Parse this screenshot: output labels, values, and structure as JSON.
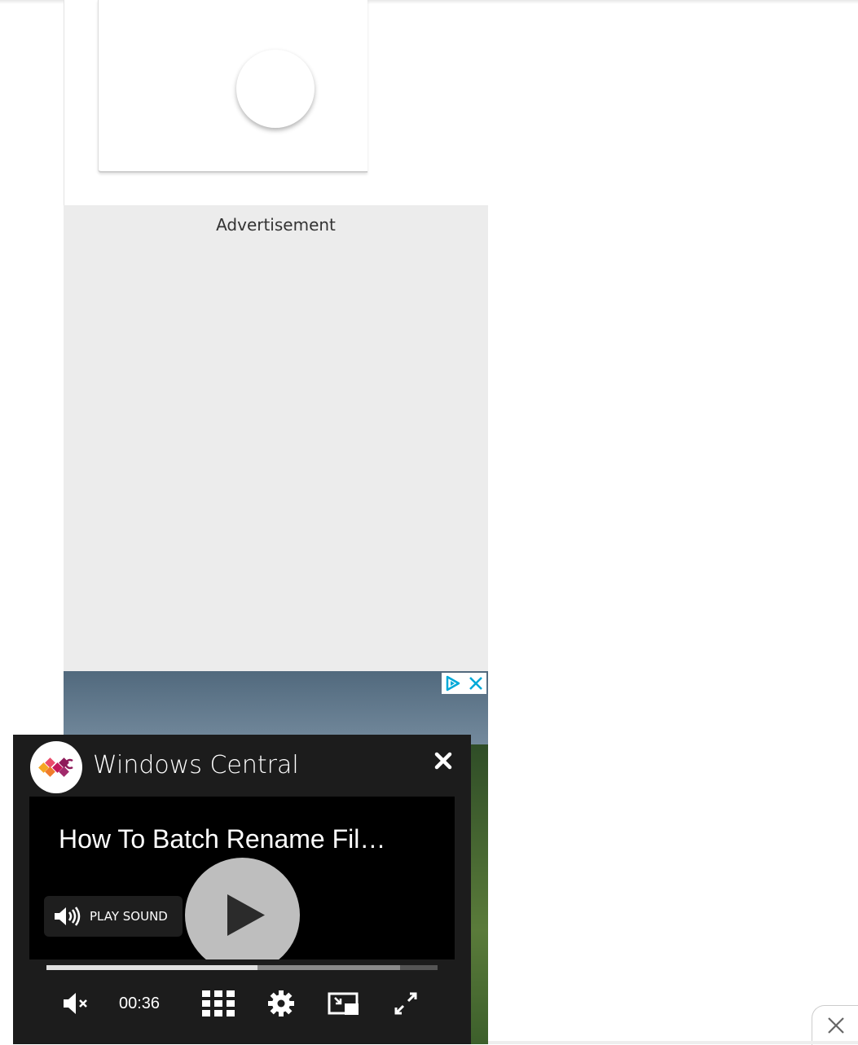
{
  "ad": {
    "label": "Advertisement"
  },
  "player": {
    "brand": "Windows Central",
    "video_title": "How To Batch Rename Fil…",
    "play_sound_label": "PLAY SOUND",
    "time": "00:36",
    "progress_played_fraction": 0.54,
    "progress_buffered_fraction": 0.905
  },
  "icons": {
    "close": "close-icon",
    "speaker": "speaker-icon",
    "mute": "mute-icon",
    "grid": "grid-icon",
    "gear": "gear-icon",
    "pip": "picture-in-picture-icon",
    "fullscreen": "fullscreen-icon",
    "play": "play-icon",
    "adchoices": "adchoices-icon"
  },
  "colors": {
    "player_bg": "#1c1c1c",
    "ad_bg": "#ececec",
    "adchoices_accent": "#00a9d8"
  }
}
